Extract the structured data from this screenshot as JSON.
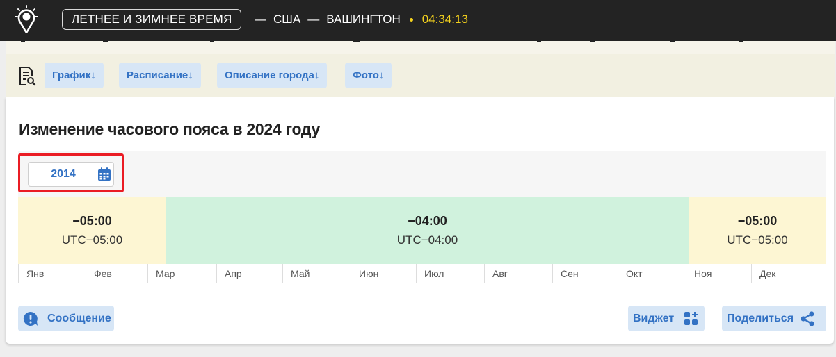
{
  "header": {
    "title_button": "ЛЕТНЕЕ И ЗИМНЕЕ ВРЕМЯ",
    "breadcrumb_sep": "—",
    "country": "США",
    "city": "ВАШИНГТОН",
    "clock": "04:34:13",
    "accent_color": "#f3d11d",
    "logo_icon": "map-pin-sun-icon"
  },
  "anchor_nav": {
    "icon": "document-search-icon",
    "items": [
      {
        "label": "График"
      },
      {
        "label": "Расписание"
      },
      {
        "label": "Описание города"
      },
      {
        "label": "Фото"
      }
    ],
    "arrow": "↓"
  },
  "card": {
    "title": "Изменение часового пояса в 2024 году",
    "year_picker": {
      "value": "2014",
      "icon": "calendar-icon"
    },
    "bands": [
      {
        "offset": "−05:00",
        "utc": "UTC−05:00",
        "color": "#fdf6d3"
      },
      {
        "offset": "−04:00",
        "utc": "UTC−04:00",
        "color": "#d0f2dd"
      },
      {
        "offset": "−05:00",
        "utc": "UTC−05:00",
        "color": "#fdf6d3"
      }
    ],
    "months": [
      "Янв",
      "Фев",
      "Мар",
      "Апр",
      "Май",
      "Июн",
      "Июл",
      "Авг",
      "Сен",
      "Окт",
      "Ноя",
      "Дек"
    ],
    "actions": {
      "message": {
        "label": "Сообщение",
        "icon": "alert-bubble-icon"
      },
      "widget": {
        "label": "Виджет",
        "icon": "widget-grid-icon"
      },
      "share": {
        "label": "Поделиться",
        "icon": "share-icon"
      }
    },
    "link_color": "#3372c4",
    "highlight_color": "#ea1c24"
  }
}
